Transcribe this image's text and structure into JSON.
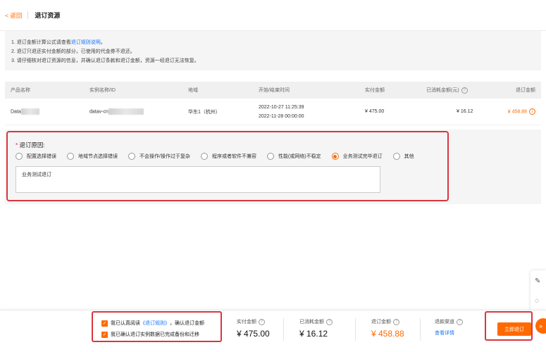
{
  "header": {
    "back_label": "< 返回",
    "title": "退订资源"
  },
  "notice": {
    "line1_prefix": "1. 退订金额计算公式请查看",
    "line1_link": "退订规则说明",
    "line1_suffix": "。",
    "line2": "2. 退订只退还实付金额的部分，已使用的代金券不退还。",
    "line3": "3. 请仔细核对退订资源的信息，并确认退订条款和退订金额，资源一经退订无法恢复。"
  },
  "table": {
    "headers": {
      "product": "产品名称",
      "instance": "实例名称/ID",
      "region": "地域",
      "time": "开始/结束时间",
      "paid": "实付金额",
      "consumed": "已消耗金额(元)",
      "refund": "退订金额"
    },
    "row": {
      "product": "Data",
      "instance": "datav-cn",
      "region": "华东1（杭州）",
      "start": "2022-10-27 11:25:39",
      "end": "2022-11-28 00:00:00",
      "paid": "¥ 475.00",
      "consumed": "¥ 16.12",
      "refund": "¥ 458.88"
    }
  },
  "reason": {
    "title": "退订原因:",
    "options": [
      "配置选择错误",
      "地域节点选择错误",
      "不会操作/操作过于复杂",
      "程序或者软件不兼容",
      "性能(或网络)不稳定",
      "业务测试完毕退订",
      "其他"
    ],
    "selected_index": 5,
    "textarea_value": "业务测试退订"
  },
  "footer": {
    "agree1_prefix": "我已认真阅读",
    "agree1_link": "《退订规则》",
    "agree1_suffix": "，确认退订金额",
    "agree2": "我已确认退订实例数据已完成备份和迁移",
    "paid_label": "实付金额",
    "paid_value": "¥ 475.00",
    "consumed_label": "已消耗金额",
    "consumed_value": "¥ 16.12",
    "refund_label": "退订金额",
    "refund_value": "¥ 458.88",
    "channel_label": "退款渠道",
    "channel_link": "查看详情",
    "submit": "立即退订",
    "fab": "»"
  },
  "colors": {
    "accent": "#ff6a00",
    "link": "#1677ff",
    "highlight_border": "#d9363e"
  }
}
